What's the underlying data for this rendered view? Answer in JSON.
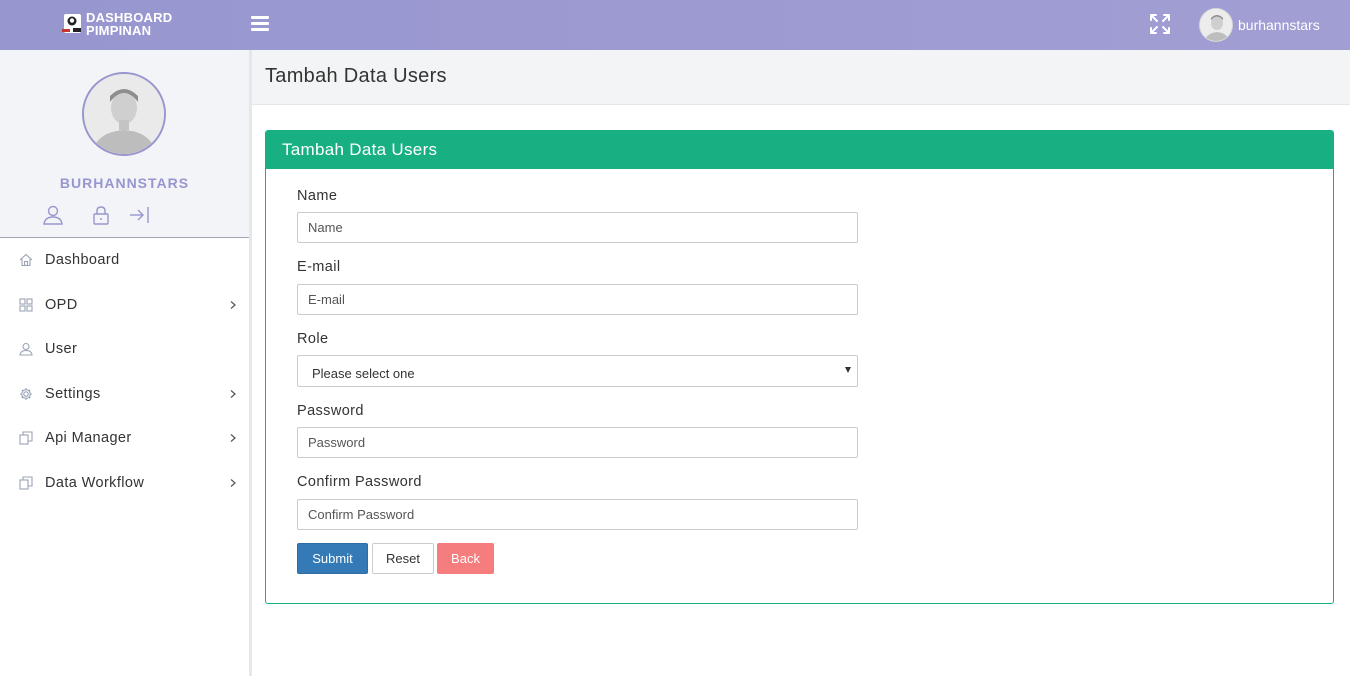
{
  "app": {
    "logo_line1": "DASHBOARD",
    "logo_line2": "PIMPINAN",
    "username": "burhannstars"
  },
  "profile": {
    "name": "BURHANNSTARS"
  },
  "sidebar": {
    "items": [
      {
        "label": "Dashboard",
        "icon": "home-icon",
        "has_submenu": false
      },
      {
        "label": "OPD",
        "icon": "grid-icon",
        "has_submenu": true
      },
      {
        "label": "User",
        "icon": "user-icon",
        "has_submenu": false
      },
      {
        "label": "Settings",
        "icon": "gear-icon",
        "has_submenu": true
      },
      {
        "label": "Api Manager",
        "icon": "copy-icon",
        "has_submenu": true
      },
      {
        "label": "Data Workflow",
        "icon": "copy-icon",
        "has_submenu": true
      }
    ]
  },
  "page": {
    "title": "Tambah Data Users"
  },
  "panel": {
    "title": "Tambah Data Users"
  },
  "form": {
    "name_label": "Name",
    "name_placeholder": "Name",
    "email_label": "E-mail",
    "email_placeholder": "E-mail",
    "role_label": "Role",
    "role_selected": "Please select one",
    "password_label": "Password",
    "password_placeholder": "Password",
    "confirm_label": "Confirm Password",
    "confirm_placeholder": "Confirm Password",
    "submit_label": "Submit",
    "reset_label": "Reset",
    "back_label": "Back"
  },
  "colors": {
    "topbar": "#9c9ad1",
    "accent": "#9896cf",
    "panel_header": "#18b082",
    "submit": "#337ab7",
    "back": "#f57d7d"
  }
}
